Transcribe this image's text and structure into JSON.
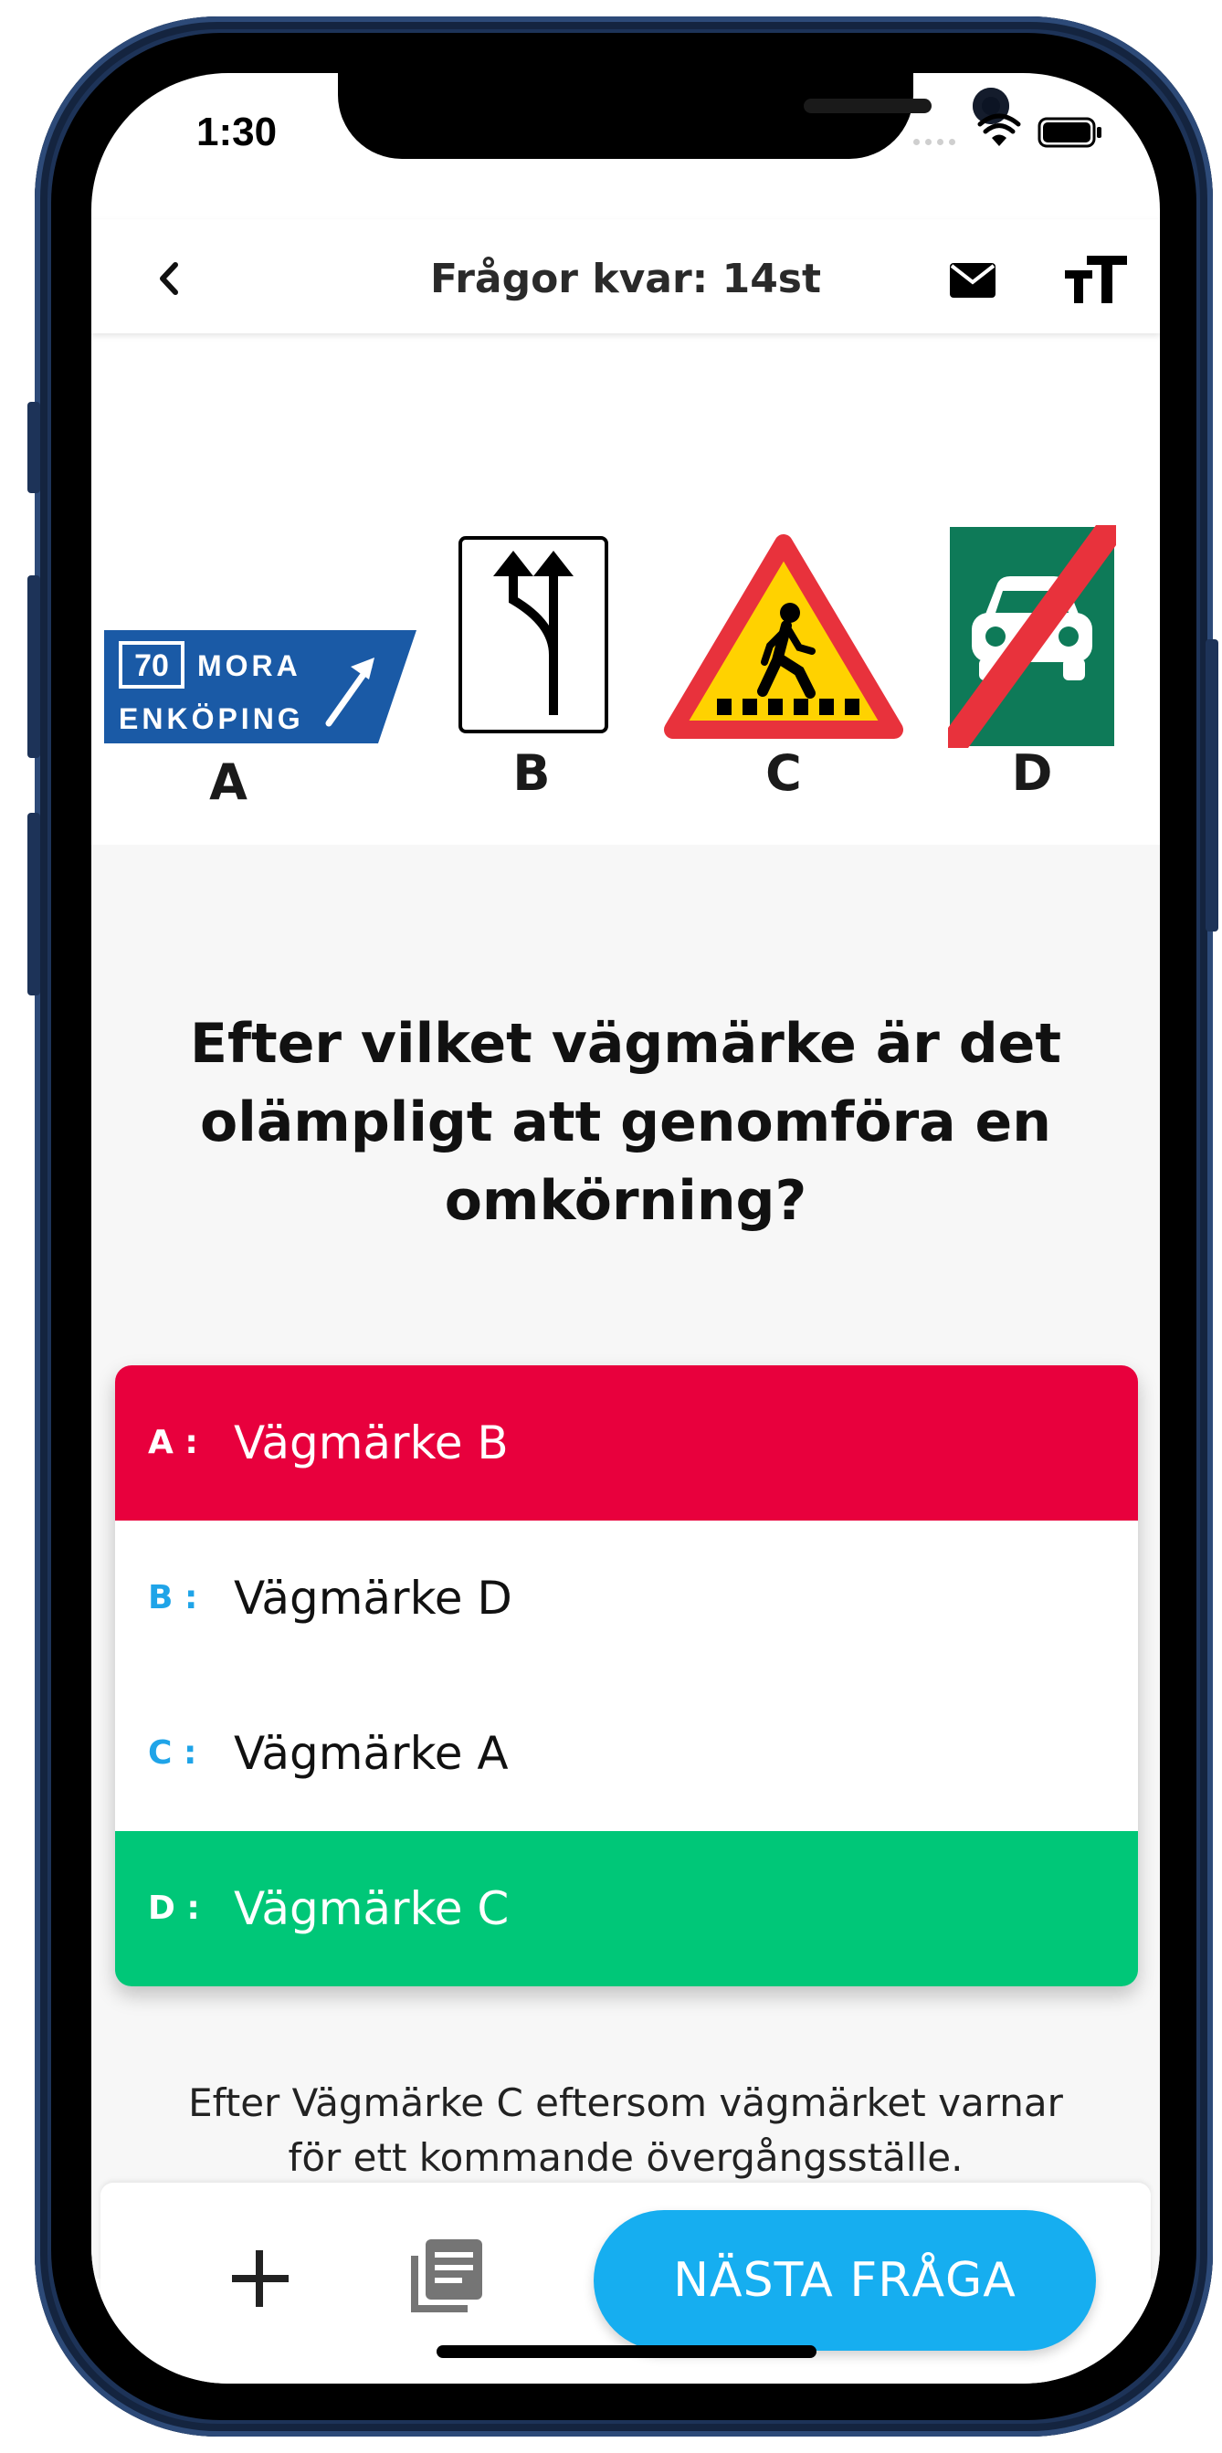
{
  "status_bar": {
    "time": "1:30"
  },
  "navbar": {
    "title": "Frågor kvar: 14st"
  },
  "signs": {
    "a": {
      "label": "A",
      "number": "70",
      "line1": "MORA",
      "line2": "ENKÖPING"
    },
    "b": {
      "label": "B"
    },
    "c": {
      "label": "C"
    },
    "d": {
      "label": "D"
    }
  },
  "question": "Efter vilket vägmärke är det olämpligt att genomföra en omkörning?",
  "answers": [
    {
      "letter": "A :",
      "text": "Vägmärke B",
      "state": "wrong"
    },
    {
      "letter": "B :",
      "text": "Vägmärke D",
      "state": "neutral"
    },
    {
      "letter": "C :",
      "text": "Vägmärke A",
      "state": "neutral"
    },
    {
      "letter": "D :",
      "text": "Vägmärke C",
      "state": "correct"
    }
  ],
  "explanation": "Efter Vägmärke C eftersom vägmärket varnar för ett kommande övergångsställe.",
  "bottom_bar": {
    "next_label": "NÄSTA FRÅGA"
  },
  "colors": {
    "wrong": "#e8003d",
    "correct": "#00c778",
    "accent": "#16aef0",
    "sign_blue": "#1a5aa6",
    "sign_green": "#0e7a58",
    "sign_red": "#e8323c",
    "sign_yellow": "#ffd200"
  }
}
